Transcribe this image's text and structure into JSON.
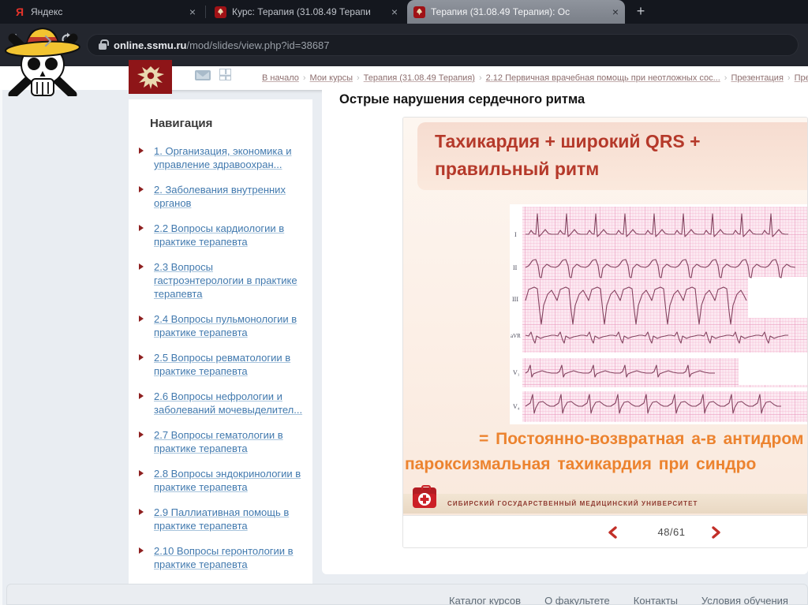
{
  "browser": {
    "tabs": [
      {
        "title": "Яндекс"
      },
      {
        "title": "Курс: Терапия (31.08.49 Терапи"
      },
      {
        "title": "Терапия (31.08.49 Терапия): Ос"
      }
    ],
    "new_tab": "+",
    "close": "×",
    "url_domain": "online.ssmu.ru",
    "url_path": "/mod/slides/view.php?id=38687"
  },
  "header": {
    "separator": "›",
    "breadcrumb": [
      {
        "label": "В начало"
      },
      {
        "label": "Мои курсы"
      },
      {
        "label": "Терапия (31.08.49 Терапия)"
      },
      {
        "label": "2.12 Первичная врачебная помощь при неотложных сос..."
      },
      {
        "label": "Презентация"
      },
      {
        "label": "Презентация"
      }
    ]
  },
  "sidebar": {
    "title": "Навигация",
    "items": [
      {
        "label": "1. Организация, экономика и управление здравоохран..."
      },
      {
        "label": "2. Заболевания внутренних органов"
      },
      {
        "label": "2.2 Вопросы кардиологии в практике терапевта"
      },
      {
        "label": "2.3 Вопросы гастроэнтерологии в практике терапевта"
      },
      {
        "label": "2.4 Вопросы пульмонологии в практике терапевта"
      },
      {
        "label": "2.5 Вопросы ревматологии в практике терапевта"
      },
      {
        "label": "2.6 Вопросы нефрологии и заболеваний мочевыделител..."
      },
      {
        "label": "2.7 Вопросы гематологии в практике терапевта"
      },
      {
        "label": "2.8 Вопросы эндокринологии в практике терапевта"
      },
      {
        "label": "2.9 Паллиативная помощь в практике терапевта"
      },
      {
        "label": "2.10 Вопросы геронтологии в практике терапевта"
      }
    ]
  },
  "main": {
    "page_title": "Острые нарушения сердечного ритма",
    "slide": {
      "title_line1": "Тахикардия + широкий QRS +",
      "title_line2": "правильный ритм",
      "ecg_leads": [
        {
          "label": "I"
        },
        {
          "label": "II"
        },
        {
          "label": "III"
        },
        {
          "label": "aVR"
        },
        {
          "label": "V₁"
        },
        {
          "label": "V₄"
        }
      ],
      "caption_line1": "= Постоянно-возвратная а-в антидром",
      "caption_line2": "пароксизмальная тахикардия при синдро",
      "university": "СИБИРСКИЙ ГОСУДАРСТВЕННЫЙ МЕДИЦИНСКИЙ УНИВЕРСИТЕТ"
    },
    "pagination": {
      "current": "48/61"
    }
  },
  "footer": {
    "links": [
      {
        "label": "Каталог курсов"
      },
      {
        "label": "О факультете"
      },
      {
        "label": "Контакты"
      },
      {
        "label": "Условия обучения"
      }
    ]
  },
  "colors": {
    "accent_red": "#b5392a",
    "orange": "#ec832f",
    "link_blue": "#4179ae",
    "chrome_dark": "#14171e"
  }
}
